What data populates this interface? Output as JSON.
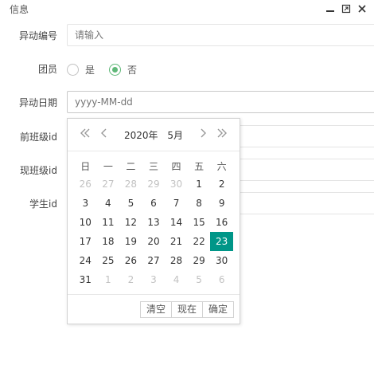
{
  "window": {
    "title": "信息"
  },
  "form": {
    "change_no": {
      "label": "异动编号",
      "placeholder": "请输入"
    },
    "league_member": {
      "label": "团员",
      "options": [
        "是",
        "否"
      ],
      "selected": "否"
    },
    "change_date": {
      "label": "异动日期",
      "placeholder": "yyyy-MM-dd"
    },
    "prev_class_id": {
      "label": "前班级id"
    },
    "curr_class_id": {
      "label": "现班级id"
    },
    "student_id": {
      "label": "学生id"
    }
  },
  "datepicker": {
    "year_label": "2020年",
    "month_label": "5月",
    "weekdays": [
      "日",
      "一",
      "二",
      "三",
      "四",
      "五",
      "六"
    ],
    "weeks": [
      [
        {
          "d": "26",
          "o": true
        },
        {
          "d": "27",
          "o": true
        },
        {
          "d": "28",
          "o": true
        },
        {
          "d": "29",
          "o": true
        },
        {
          "d": "30",
          "o": true
        },
        {
          "d": "1"
        },
        {
          "d": "2"
        }
      ],
      [
        {
          "d": "3"
        },
        {
          "d": "4"
        },
        {
          "d": "5"
        },
        {
          "d": "6"
        },
        {
          "d": "7"
        },
        {
          "d": "8"
        },
        {
          "d": "9"
        }
      ],
      [
        {
          "d": "10"
        },
        {
          "d": "11"
        },
        {
          "d": "12"
        },
        {
          "d": "13"
        },
        {
          "d": "14"
        },
        {
          "d": "15"
        },
        {
          "d": "16"
        }
      ],
      [
        {
          "d": "17"
        },
        {
          "d": "18"
        },
        {
          "d": "19"
        },
        {
          "d": "20"
        },
        {
          "d": "21"
        },
        {
          "d": "22"
        },
        {
          "d": "23",
          "s": true
        }
      ],
      [
        {
          "d": "24"
        },
        {
          "d": "25"
        },
        {
          "d": "26"
        },
        {
          "d": "27"
        },
        {
          "d": "28"
        },
        {
          "d": "29"
        },
        {
          "d": "30"
        }
      ],
      [
        {
          "d": "31"
        },
        {
          "d": "1",
          "o": true
        },
        {
          "d": "2",
          "o": true
        },
        {
          "d": "3",
          "o": true
        },
        {
          "d": "4",
          "o": true
        },
        {
          "d": "5",
          "o": true
        },
        {
          "d": "6",
          "o": true
        }
      ]
    ],
    "buttons": {
      "clear": "清空",
      "now": "现在",
      "confirm": "确定"
    },
    "colors": {
      "selected": "#009688",
      "radio_checked": "#5FB878"
    }
  }
}
